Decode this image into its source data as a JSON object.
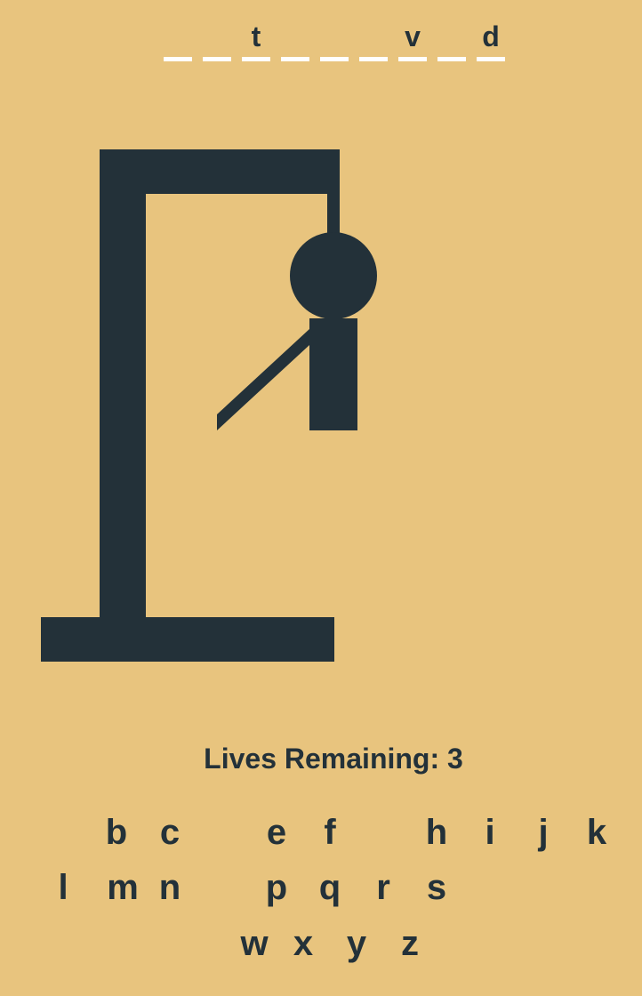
{
  "word": [
    "",
    "",
    "t",
    "",
    "",
    "",
    "v",
    "",
    "d"
  ],
  "lives": {
    "label": "Lives Remaining: 3"
  },
  "keyboard": {
    "row1": [
      "",
      "b",
      "c",
      "",
      "e",
      "f",
      "",
      "h",
      "i",
      "j",
      "k"
    ],
    "row2": [
      "l",
      "m",
      "n",
      "",
      "p",
      "q",
      "r",
      "s",
      "",
      "",
      ""
    ],
    "row3": [
      "w",
      "x",
      "y",
      "z"
    ]
  },
  "colors": {
    "background": "#E8C47E",
    "ink": "#233139",
    "dash": "#FFFFFF"
  }
}
